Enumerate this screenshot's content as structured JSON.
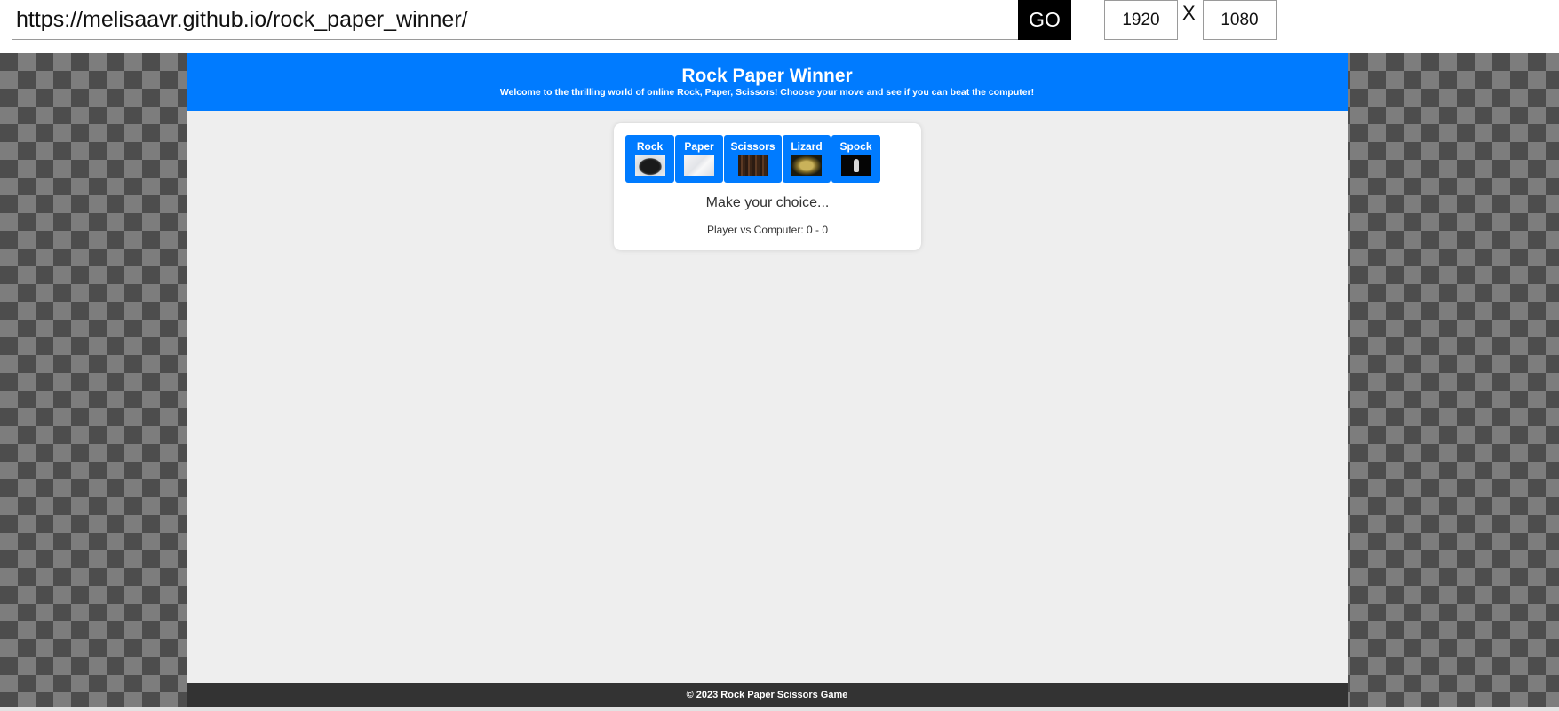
{
  "toolbar": {
    "url": "https://melisaavr.github.io/rock_paper_winner/",
    "go_label": "GO",
    "width_value": "1920",
    "separator": "X",
    "height_value": "1080"
  },
  "site": {
    "title": "Rock Paper Winner",
    "tagline": "Welcome to the thrilling world of online Rock, Paper, Scissors! Choose your move and see if you can beat the computer!",
    "choices": [
      {
        "label": "Rock",
        "image": "rock-photo"
      },
      {
        "label": "Paper",
        "image": "paper-photo"
      },
      {
        "label": "Scissors",
        "image": "scissors-photo"
      },
      {
        "label": "Lizard",
        "image": "lizard-photo"
      },
      {
        "label": "Spock",
        "image": "spock-hand-photo"
      }
    ],
    "status": "Make your choice...",
    "score": "Player vs Computer: 0 - 0",
    "footer": "© 2023 Rock Paper Scissors Game",
    "colors": {
      "header": "#007bff",
      "button": "#007bff",
      "footer": "#333333",
      "page_background": "#eeeeee"
    }
  }
}
